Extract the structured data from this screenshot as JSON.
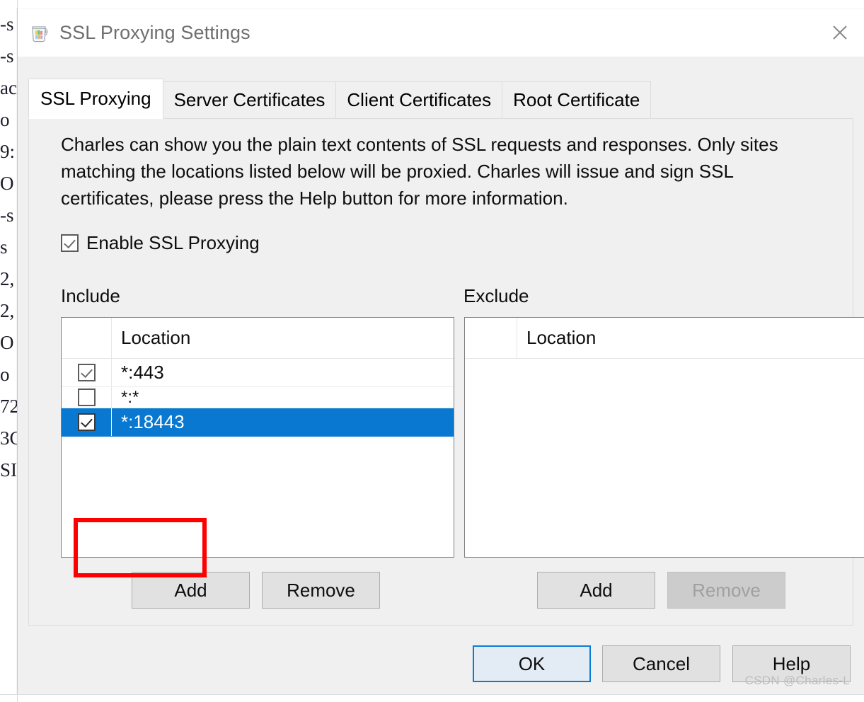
{
  "window": {
    "title": "SSL Proxying Settings",
    "icon": "charles-jug-icon",
    "close_icon": "close-icon"
  },
  "tabs": [
    {
      "label": "SSL Proxying",
      "active": true
    },
    {
      "label": "Server Certificates",
      "active": false
    },
    {
      "label": "Client Certificates",
      "active": false
    },
    {
      "label": "Root Certificate",
      "active": false
    }
  ],
  "panel": {
    "description": "Charles can show you the plain text contents of SSL requests and responses. Only sites matching the locations listed below will be proxied. Charles will issue and sign SSL certificates, please press the Help button for more information.",
    "enable_checkbox": {
      "label": "Enable SSL Proxying",
      "checked": true
    },
    "include": {
      "section_label": "Include",
      "column_header": "Location",
      "rows": [
        {
          "location": "*:443",
          "checked": true,
          "selected": false
        },
        {
          "location": "*:*",
          "checked": false,
          "selected": false
        },
        {
          "location": "*:18443",
          "checked": true,
          "selected": true
        }
      ],
      "add_label": "Add",
      "remove_label": "Remove",
      "remove_disabled": false
    },
    "exclude": {
      "section_label": "Exclude",
      "column_header": "Location",
      "rows": [],
      "add_label": "Add",
      "remove_label": "Remove",
      "remove_disabled": true
    }
  },
  "footer": {
    "ok_label": "OK",
    "cancel_label": "Cancel",
    "help_label": "Help"
  },
  "annotation": {
    "type": "rectangle",
    "color": "#ff0000",
    "target": "*:18443"
  },
  "watermark": "CSDN @Charles-L",
  "colors": {
    "selection_blue": "#0878d0",
    "dialog_background": "#f0f0f0",
    "titlebar_background": "#ffffff",
    "title_text": "#6e6e6e",
    "annotation_red": "#ff0000",
    "disabled_text": "#a0a0a0"
  },
  "background_app": {
    "clipped_text_fragments": [
      "-s",
      "-s",
      "ac",
      "o",
      "9:",
      "O",
      "-s",
      "s",
      "2,",
      "2,",
      "O",
      "o",
      "72",
      "3C",
      "SI"
    ]
  }
}
